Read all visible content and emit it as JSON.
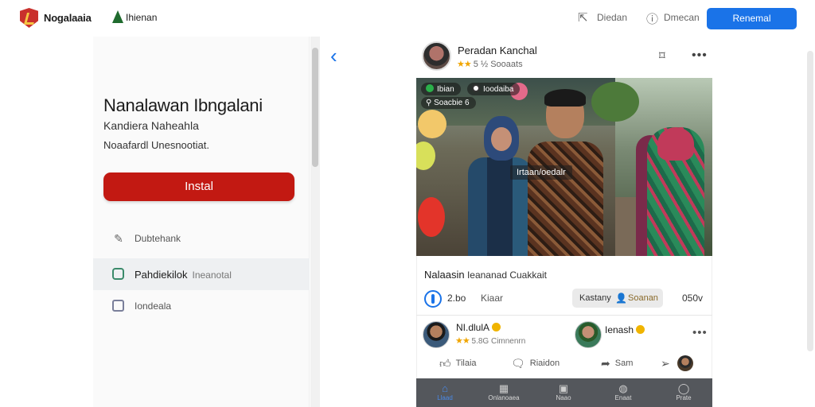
{
  "topbar": {
    "brand": "Nogalaaia",
    "brand2": "Ihienan",
    "link1": "Diedan",
    "link2": "Dmecan",
    "primary_button": "Renemal"
  },
  "left_panel": {
    "title": "Nanalawan Ibngalani",
    "subtitle": "Kandiera Naheahla",
    "description": "Noaafardl Unesnootiat.",
    "install_label": "Instal",
    "items": [
      {
        "label": "Dubtehank",
        "icon": "edit-icon"
      },
      {
        "label": "Pahdiekilok",
        "label_extra": "Ineanotal",
        "icon": "checkbox-icon"
      },
      {
        "label": "Iondeala",
        "icon": "square-icon"
      }
    ]
  },
  "post": {
    "author": "Peradan Kanchal",
    "meta_stars": "★★",
    "meta": "5 ½ Sooaats",
    "photo_chip1": "Ibian",
    "photo_chip2": "Ioodaiba",
    "photo_chip3": "Soacbie",
    "photo_chip3_num": "6",
    "photo_label": "Irtaan/oedalr",
    "caption_bold": "Nalaasin",
    "caption": "Ieananad Cuakkait",
    "reaction_count": "2.bo",
    "reaction_label": "Kiaar",
    "pill_left": "Kastany",
    "pill_right": "Soanan",
    "count_right": "050v"
  },
  "comments": [
    {
      "name": "NI.dlulA",
      "stars": "★★",
      "meta": "5.8G Cimnenrn"
    },
    {
      "name": "Ienash"
    }
  ],
  "actions": [
    {
      "label": "Tilaia",
      "icon": "like-icon"
    },
    {
      "label": "Riaidon",
      "icon": "comment-icon"
    },
    {
      "label": "Sam",
      "icon": "share-icon"
    }
  ],
  "bottom_nav": [
    {
      "label": "Llaad",
      "icon": "home-icon"
    },
    {
      "label": "Onlanoaea",
      "icon": "grid-icon"
    },
    {
      "label": "Naao",
      "icon": "inbox-icon"
    },
    {
      "label": "Enaat",
      "icon": "globe-icon"
    },
    {
      "label": "Prate",
      "icon": "profile-icon"
    }
  ],
  "colors": {
    "accent_blue": "#1a73e8",
    "install_red": "#c21912",
    "bottom_nav_bg": "#54575c"
  }
}
